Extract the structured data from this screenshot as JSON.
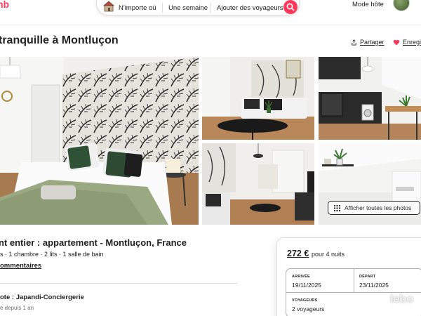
{
  "header": {
    "logo": "nb",
    "search": {
      "where": "N'importe où",
      "when": "Une semaine",
      "who": "Ajouter des voyageurs"
    },
    "host_link": "Mode hôte"
  },
  "listing": {
    "title": "tranquille à Montluçon",
    "share_label": "Partager",
    "save_label": "Enregi",
    "show_all_photos": "Afficher toutes les photos",
    "subtitle": "nt entier : appartement - Montluçon, France",
    "details": "s · 1 chambre · 2 lits · 1 salle de bain",
    "comments": "ommentaires",
    "host_line": "ote : Japandi-Conciergerie",
    "host_since": "e depuis 1 an"
  },
  "booking": {
    "price": "272 €",
    "price_note": "pour 4 nuits",
    "arrival_label": "ARRIVÉE",
    "arrival_value": "19/11/2025",
    "departure_label": "DÉPART",
    "departure_value": "23/11/2025",
    "guests_label": "VOYAGEURS",
    "guests_value": "2 voyageurs"
  },
  "watermark": "lebo",
  "colors": {
    "brand": "#ff385c",
    "text": "#222222",
    "muted": "#717171",
    "border": "#dddddd"
  }
}
